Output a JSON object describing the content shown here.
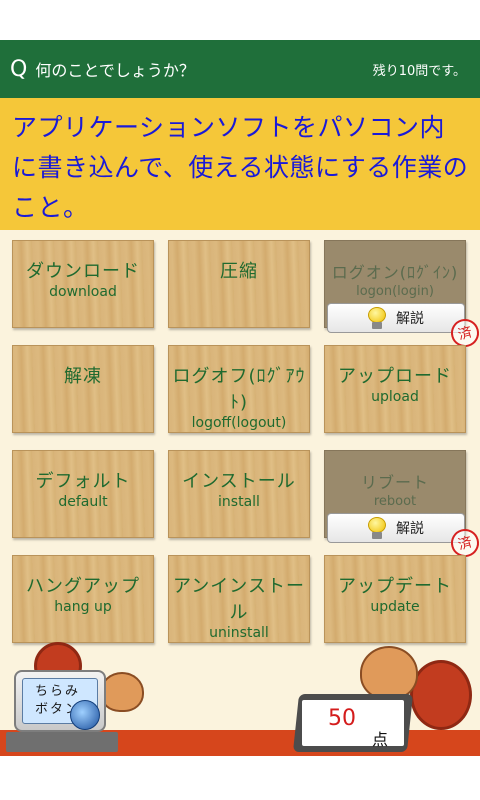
{
  "header": {
    "q_label": "Q",
    "prompt": "何のことでしょうか？",
    "remaining": "残り10問です。"
  },
  "question": {
    "text": "アプリケーションソフトをパソコン内に書き込んで、使える状態にする作業のこと。"
  },
  "tiles": [
    {
      "jp": "ダウンロード",
      "en": "download",
      "used": false
    },
    {
      "jp": "圧縮",
      "en": "",
      "used": false
    },
    {
      "jp": "ログオン(ﾛｸﾞｲﾝ)",
      "en": "logon(login)",
      "used": true
    },
    {
      "jp": "解凍",
      "en": "",
      "used": false
    },
    {
      "jp": "ログオフ(ﾛｸﾞｱｳﾄ)",
      "en": "logoff(logout)",
      "used": false
    },
    {
      "jp": "アップロード",
      "en": "upload",
      "used": false
    },
    {
      "jp": "デフォルト",
      "en": "default",
      "used": false
    },
    {
      "jp": "インストール",
      "en": "install",
      "used": false
    },
    {
      "jp": "リブート",
      "en": "reboot",
      "used": true
    },
    {
      "jp": "ハングアップ",
      "en": "hang up",
      "used": false
    },
    {
      "jp": "アンインストール",
      "en": "uninstall",
      "used": false
    },
    {
      "jp": "アップデート",
      "en": "update",
      "used": false
    }
  ],
  "explain_label": "解説",
  "used_stamp": "済",
  "chirami": {
    "line1": "ちらみ",
    "line2": "ボタン"
  },
  "score": {
    "value": "50",
    "unit": "点"
  },
  "colors": {
    "header": "#1f6f3a",
    "question_bg": "#f5c739",
    "question_text": "#1a1ad8",
    "tile_text": "#1f6a2f",
    "floor": "#d6461c"
  }
}
